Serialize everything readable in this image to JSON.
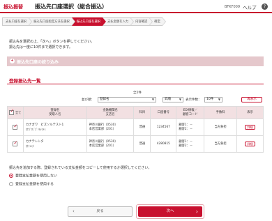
{
  "header": {
    "category": "振込振替",
    "title": "振込先口座選択（総合振込）",
    "code": "BFKF009",
    "help_label": "ヘルプ",
    "help_icon": "?"
  },
  "steps": [
    {
      "label": "支払口座を選択",
      "active": false
    },
    {
      "label": "振込先口座指定方法を選択",
      "active": false
    },
    {
      "label": "振込先口座を選択",
      "active": true
    },
    {
      "label": "支払金額を入力",
      "active": false
    },
    {
      "label": "内容確認",
      "active": false
    },
    {
      "label": "確定",
      "active": false
    }
  ],
  "description": {
    "line1": "振込先を選択の上、「次へ」ボタンを押してください。",
    "line2": "振込先は一度に10件まで選択できます。"
  },
  "filter": {
    "icon": "+",
    "label": "振込先口座の絞り込み"
  },
  "registered": {
    "title": "登録振込先一覧",
    "count": "全2件",
    "sort_label": "並び順：",
    "sort_value": "登録名",
    "order_value": "昇順",
    "per_page_label": "表示件数：",
    "per_page_value": "10件",
    "redisplay_label": "再表示"
  },
  "table": {
    "headers": {
      "all": "全て",
      "name_top": "登録名",
      "name_bottom": "受取人名",
      "bank_top": "金融機関名",
      "bank_bottom": "支店名",
      "type": "科目",
      "account": "口座番号",
      "edi_top": "EDI情報／",
      "edi_bottom": "顧客コード",
      "fee": "手数料",
      "show": "表示"
    },
    "rows": [
      {
        "checked": true,
        "name": "カナガワ　ビズソルテスト1",
        "recipient": "ｶﾅｶﾞﾜﾋﾞｽﾞｿﾙﾃｽﾄ1",
        "bank": "神奈川銀行（0530）",
        "branch": "本店営業部（201）",
        "type": "普通",
        "account": "1234567",
        "code1": "顧客1：－",
        "code2": "顧客2：－",
        "fee": "当方負担",
        "detail_label": "詳細"
      },
      {
        "checked": true,
        "name": "カナテレシタ",
        "recipient": "ｶﾅﾃﾚｼﾀ",
        "bank": "神奈川銀行（0530）",
        "branch": "本店営業部（201）",
        "type": "普通",
        "account": "4280815",
        "code1": "顧客1：－",
        "code2": "顧客2：－",
        "fee": "当方負担",
        "detail_label": "詳細"
      }
    ]
  },
  "copy_option": {
    "note": "振込先を追加する際、登録されている支払金額をコピーして使用するか選択してください。",
    "options": [
      {
        "label": "登録支払金額を使用しない",
        "selected": true
      },
      {
        "label": "登録支払金額を使用する",
        "selected": false
      }
    ]
  },
  "buttons": {
    "back_label": "戻る",
    "next_label": "次へ"
  },
  "colors": {
    "accent": "#c8102e",
    "filter_bar": "#e5c8cc",
    "table_header": "#f2e0e2"
  }
}
